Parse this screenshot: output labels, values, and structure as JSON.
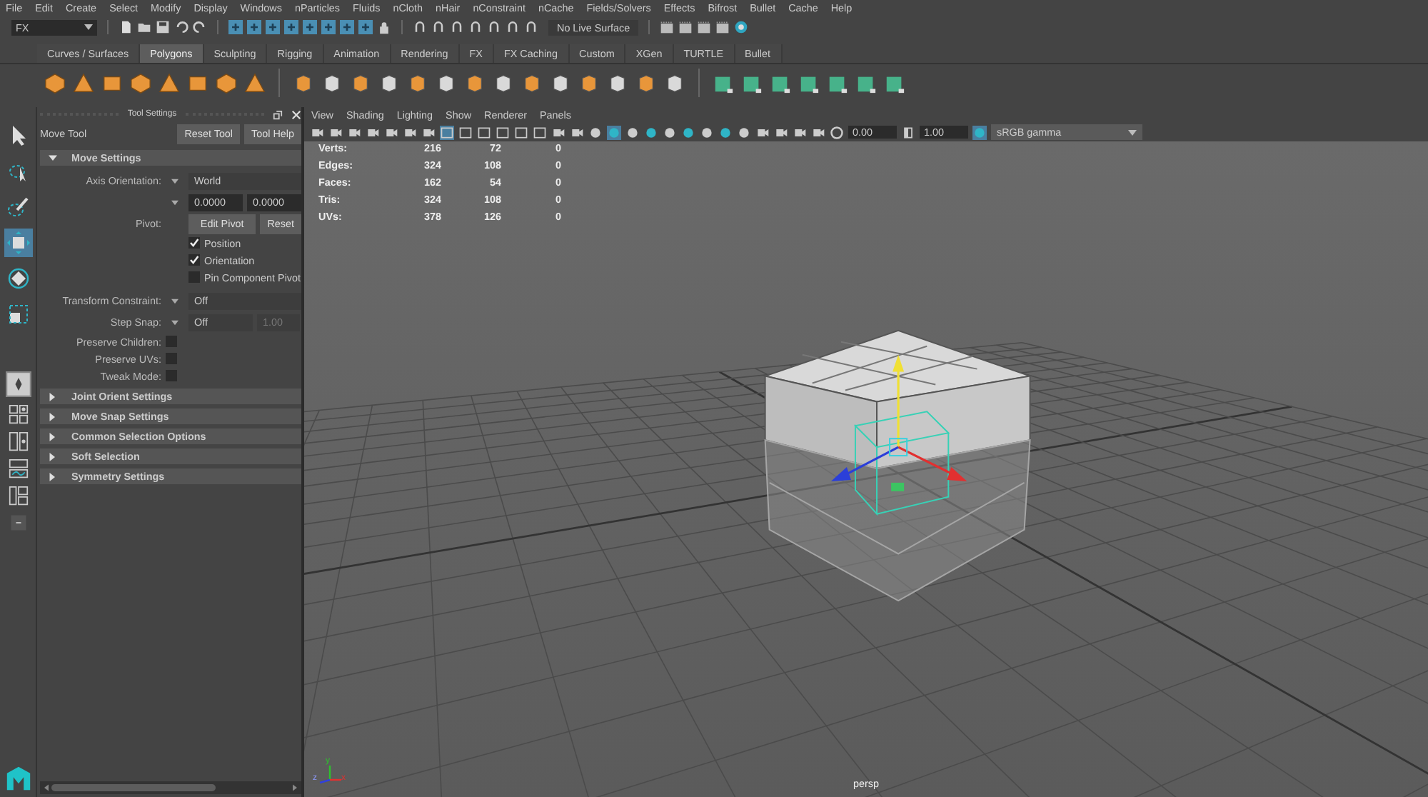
{
  "menu_bar": [
    "File",
    "Edit",
    "Create",
    "Select",
    "Modify",
    "Display",
    "Windows",
    "nParticles",
    "Fluids",
    "nCloth",
    "nHair",
    "nConstraint",
    "nCache",
    "Fields/Solvers",
    "Effects",
    "Bifrost",
    "Bullet",
    "Cache",
    "Help"
  ],
  "status_line": {
    "mode": "FX",
    "live_surface": "No Live Surface"
  },
  "shelf": {
    "tabs": [
      {
        "label": "Curves / Surfaces",
        "selected": false
      },
      {
        "label": "Polygons",
        "selected": true
      },
      {
        "label": "Sculpting",
        "selected": false
      },
      {
        "label": "Rigging",
        "selected": false
      },
      {
        "label": "Animation",
        "selected": false
      },
      {
        "label": "Rendering",
        "selected": false
      },
      {
        "label": "FX",
        "selected": false
      },
      {
        "label": "FX Caching",
        "selected": false
      },
      {
        "label": "Custom",
        "selected": false
      },
      {
        "label": "XGen",
        "selected": false
      },
      {
        "label": "TURTLE",
        "selected": false
      },
      {
        "label": "Bullet",
        "selected": false
      }
    ]
  },
  "toolbox": {
    "tools": [
      {
        "kind": "select",
        "selected": false
      },
      {
        "kind": "lasso",
        "selected": false
      },
      {
        "kind": "paint",
        "selected": false
      },
      {
        "kind": "move",
        "selected": true
      },
      {
        "kind": "rotate",
        "selected": false
      },
      {
        "kind": "scale",
        "selected": false
      }
    ]
  },
  "tool_settings": {
    "title": "Tool Settings",
    "tool_name": "Move Tool",
    "buttons": [
      "Reset Tool",
      "Tool Help"
    ],
    "section": {
      "label": "Move Settings",
      "expanded": true
    },
    "axis_orientation": {
      "label": "Axis Orientation:",
      "value": "World"
    },
    "custom_values": [
      "0.0000",
      "0.0000"
    ],
    "pivot": {
      "label": "Pivot:",
      "buttons": [
        "Edit Pivot",
        "Reset"
      ]
    },
    "pivot_options": [
      {
        "label": "Position",
        "checked": true
      },
      {
        "label": "Orientation",
        "checked": true
      },
      {
        "label": "Pin Component Pivot",
        "checked": false
      }
    ],
    "transform_constraint": {
      "label": "Transform Constraint:",
      "value": "Off"
    },
    "step_snap": {
      "label": "Step Snap:",
      "value": "Off",
      "amount": "1.00"
    },
    "preserve": [
      {
        "label": "Preserve Children:",
        "checked": false
      },
      {
        "label": "Preserve UVs:",
        "checked": false
      },
      {
        "label": "Tweak Mode:",
        "checked": false
      }
    ],
    "collapsed_sections": [
      {
        "label": "Joint Orient Settings",
        "expanded": false
      },
      {
        "label": "Move Snap Settings",
        "expanded": false
      },
      {
        "label": "Common Selection Options",
        "expanded": false
      },
      {
        "label": "Soft Selection",
        "expanded": false
      },
      {
        "label": "Symmetry Settings",
        "expanded": false
      }
    ]
  },
  "viewport": {
    "menus": [
      "View",
      "Shading",
      "Lighting",
      "Show",
      "Renderer",
      "Panels"
    ],
    "exposure": "0.00",
    "gamma": "1.00",
    "color_space": "sRGB gamma",
    "stats": [
      {
        "label": "Verts:",
        "values": [
          "216",
          "72",
          "0"
        ]
      },
      {
        "label": "Edges:",
        "values": [
          "324",
          "108",
          "0"
        ]
      },
      {
        "label": "Faces:",
        "values": [
          "162",
          "54",
          "0"
        ]
      },
      {
        "label": "Tris:",
        "values": [
          "324",
          "108",
          "0"
        ]
      },
      {
        "label": "UVs:",
        "values": [
          "378",
          "126",
          "0"
        ]
      }
    ],
    "axis": {
      "x": "x",
      "y": "y",
      "z": "z"
    },
    "camera": "persp"
  }
}
